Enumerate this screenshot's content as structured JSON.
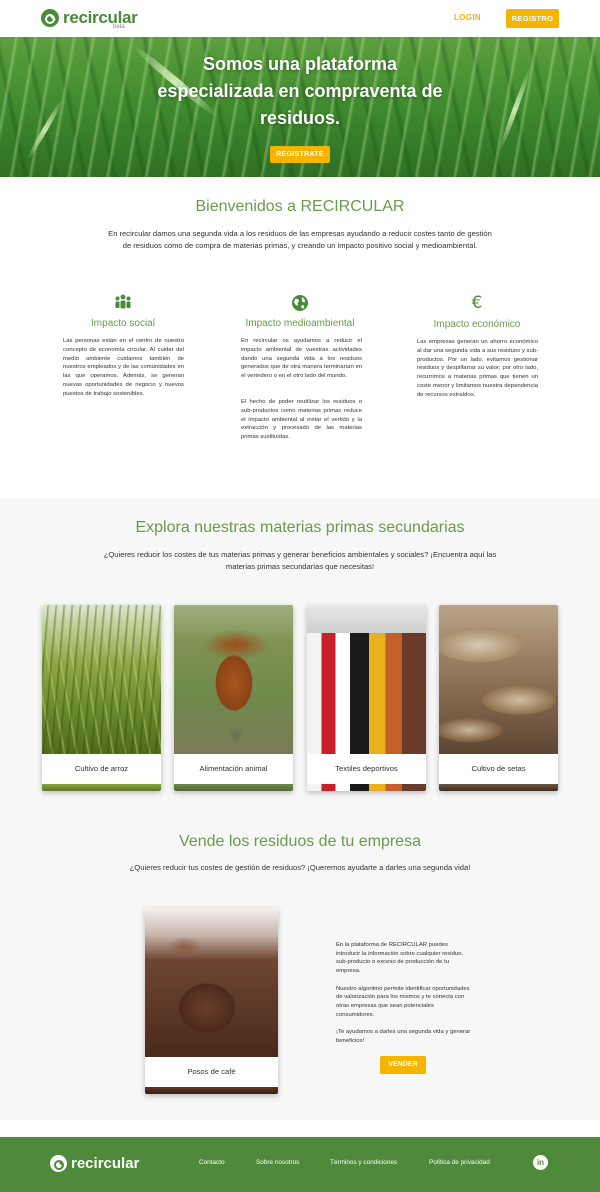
{
  "header": {
    "logo_text": "recircular",
    "logo_beta": "beta",
    "login_label": "LOGIN",
    "register_label": "REGISTRO"
  },
  "hero": {
    "title": "Somos una plataforma especializada en compraventa de residuos.",
    "cta_label": "REGISTRATE"
  },
  "welcome": {
    "title": "Bienvenidos a RECIRCULAR",
    "text": "En recircular damos una segunda vida a los residuos de las empresas ayudando a reducir costes tanto de gestión de residuos como de compra de materias primas, y creando un impacto positivo social y medioambiental."
  },
  "features": [
    {
      "icon": "people-icon",
      "title": "Impacto social",
      "text": "Las personas están en el centro de nuestro concepto de economía circular. Al cuidar del medio ambiente cuidamos también de nuestros empleados y de las comunidades en las que operamos. Además, se generan nuevas oportunidades de negocio y nuevos puestos de trabajo sostenibles."
    },
    {
      "icon": "globe-icon",
      "title": "Impacto medioambiental",
      "text": "En recircular os ayudamos a reducir el impacto ambiental de vuestras actividades dando una segunda vida a los residuos generados que de otra manera terminarían en el vertedero o en el otro lado del mundo.",
      "text2": "El hecho de poder reutilizar los residuos o sub-productos como materias primas reduce el impacto ambiental al evitar el vertido y la extracción y procesado de las materias primas sustituidas."
    },
    {
      "icon": "euro-icon",
      "title": "Impacto económico",
      "text": "Las empresas generan un ahorro económico al dar una segunda vida a sus residuos y sub-productos. Por un lado, evitamos gestionar residuos y despilfarrar su valor; por otro lado, recurrimos a materias primas que tienen un coste menor y limitamos nuestra dependencia de recursos extraídos."
    }
  ],
  "explore": {
    "title": "Explora nuestras materias primas secundarias",
    "subtitle": "¿Quieres reducir los costes de tus materias primas y generar beneficios ambientales y sociales? ¡Encuentra aquí las materias primas secundarias que necesitas!",
    "cards": [
      {
        "label": "Cultivo de arroz"
      },
      {
        "label": "Alimentación animal"
      },
      {
        "label": "Textiles deportivos"
      },
      {
        "label": "Cultivo de setas"
      }
    ]
  },
  "sell": {
    "title": "Vende los residuos de tu empresa",
    "subtitle": "¿Quieres reducir tus costes de gestión de residuos? ¡Queremos ayudarte a darles una segunda vida!",
    "card_label": "Posos de café",
    "p1": "En la plataforma de RECIRCULAR puedes introducir la información sobre cualquier residuo, sub-producto o exceso de producción de tu empresa.",
    "p2": "Nuestro algoritmo permite identificar oportunidades de valorización para los mismos y te conecta con otras empresas que sean potenciales consumidores.",
    "p3": "¡Te ayudamos a darles una segunda vida y generar beneficios!",
    "cta_label": "VENDER"
  },
  "footer": {
    "logo_text": "recircular",
    "links": [
      "Contacto",
      "Sobre nosotros",
      "Términos y condiciones",
      "Política de privacidad"
    ],
    "social_icon": "linkedin-icon",
    "social_glyph": "in"
  },
  "colors": {
    "brand_green": "#4b8a3a",
    "accent_yellow": "#f4b400",
    "heading_green": "#6b9a4c"
  }
}
